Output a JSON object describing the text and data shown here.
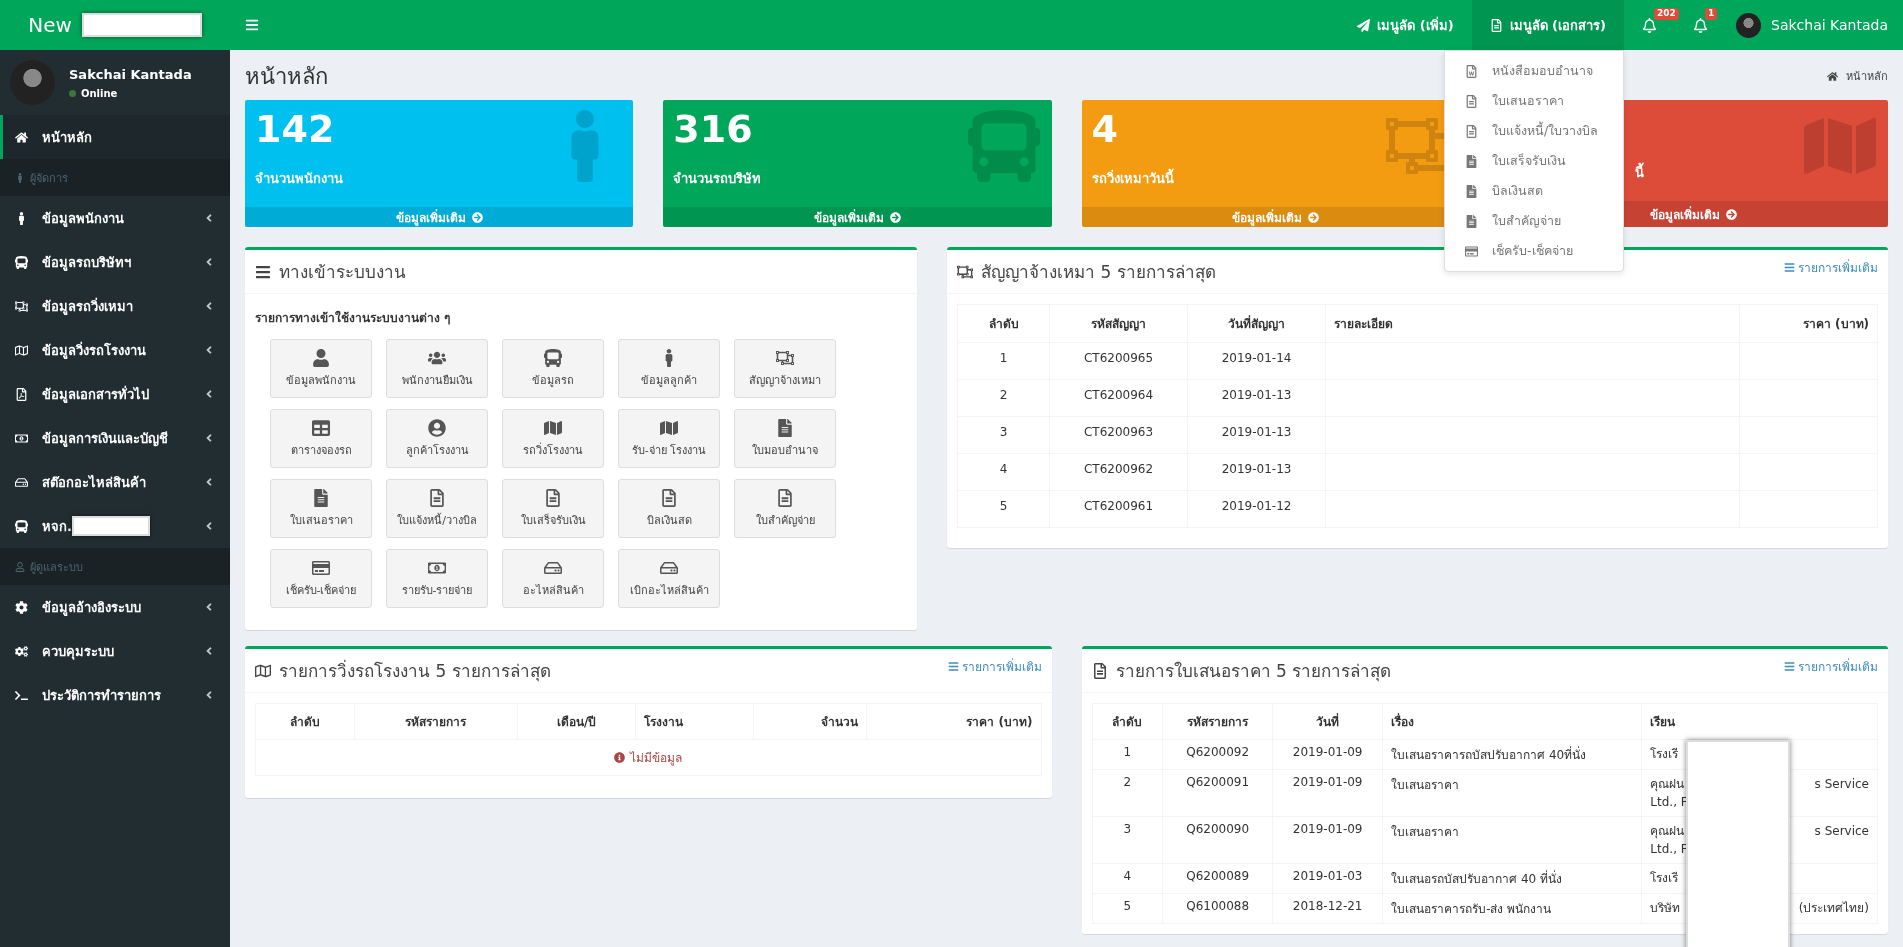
{
  "header": {
    "logo": {
      "text": "New",
      "redacted": true
    },
    "menu_links": [
      {
        "label": "เมนูลัด (เพิ่ม)",
        "selected": false
      },
      {
        "label": "เมนูลัด (เอกสาร)",
        "selected": true
      }
    ],
    "notifications": [
      {
        "badge": "202"
      },
      {
        "badge": "1"
      }
    ],
    "user": "Sakchai Kantada"
  },
  "dropdown": {
    "items": [
      "หนังสือมอบอำนาจ",
      "ใบเสนอราคา",
      "ใบแจ้งหนี้/ใบวางบิล",
      "ใบเสร็จรับเงิน",
      "บิลเงินสด",
      "ใบสำคัญจ่าย",
      "เช็ครับ-เช็คจ่าย"
    ]
  },
  "sidebar": {
    "user": {
      "name": "Sakchai Kantada",
      "status": "Online"
    },
    "items": [
      {
        "kind": "link",
        "label": "หน้าหลัก",
        "selected": true
      },
      {
        "kind": "section",
        "label": "ผู้จัดการ"
      },
      {
        "kind": "menu",
        "label": "ข้อมูลพนักงาน",
        "selected": false,
        "redacted": false
      },
      {
        "kind": "menu",
        "label": "ข้อมูลรถบริษัทฯ",
        "selected": false,
        "redacted": false
      },
      {
        "kind": "menu",
        "label": "ข้อมูลรถวิ่งเหมา",
        "selected": false,
        "redacted": false
      },
      {
        "kind": "menu",
        "label": "ข้อมูลวิ่งรถโรงงาน",
        "selected": false,
        "redacted": false
      },
      {
        "kind": "menu",
        "label": "ข้อมูลเอกสารทั่วไป",
        "selected": false,
        "redacted": false
      },
      {
        "kind": "menu",
        "label": "ข้อมูลการเงินและบัญชี",
        "selected": false,
        "redacted": false
      },
      {
        "kind": "menu",
        "label": "สต๊อกอะไหล่สินค้า",
        "selected": false,
        "redacted": false
      },
      {
        "kind": "menu",
        "label": "หจก.",
        "selected": false,
        "redacted": true
      },
      {
        "kind": "section",
        "label": "ผู้ดูแลระบบ"
      },
      {
        "kind": "menu",
        "label": "ข้อมูลอ้างอิงระบบ",
        "selected": false,
        "redacted": false
      },
      {
        "kind": "menu",
        "label": "ควบคุมระบบ",
        "selected": false,
        "redacted": false
      },
      {
        "kind": "menu",
        "label": "ประวัติการทำรายการ",
        "selected": false,
        "redacted": false
      }
    ]
  },
  "page": {
    "title": "หน้าหลัก",
    "breadcrumb": "หน้าหลัก"
  },
  "stat_cards": [
    {
      "number": "142",
      "title": "จำนวนพนักงาน",
      "link": "ข้อมูลเพิ่มเติม",
      "color": "#00c0ef"
    },
    {
      "number": "316",
      "title": "จำนวนรถบริษัท",
      "link": "ข้อมูลเพิ่มเติม",
      "color": "#00a65a"
    },
    {
      "number": "4",
      "title": "รถวิ่งเหมาวันนี้",
      "link": "ข้อมูลเพิ่มเติม",
      "color": "#f39c12"
    },
    {
      "title": "นี้",
      "link": "ข้อมูลเพิ่มเติม",
      "color": "#dd4b39"
    }
  ],
  "shortcuts": {
    "title": "ทางเข้าระบบงาน",
    "subtitle": "รายการทางเข้าใช้งานระบบงานต่าง ๆ",
    "tiles": [
      "ข้อมูลพนักงาน",
      "พนักงานยืมเงิน",
      "ข้อมูลรถ",
      "ข้อมูลลูกค้า",
      "สัญญาจ้างเหมา",
      "ตารางจองรถ",
      "ลูกค้าโรงงาน",
      "รถวิ่งโรงงาน",
      "รับ-จ่าย โรงงาน",
      "ใบมอบอำนาจ",
      "ใบเสนอราคา",
      "ใบแจ้งหนี้/วางบิล",
      "ใบเสร็จรับเงิน",
      "บิลเงินสด",
      "ใบสำคัญจ่าย",
      "เช็ครับ-เช็คจ่าย",
      "รายรับ-รายจ่าย",
      "อะไหล่สินค้า",
      "เบิกอะไหล่สินค้า"
    ]
  },
  "contracts": {
    "title": "สัญญาจ้างเหมา 5 รายการล่าสุด",
    "more": "รายการเพิ่มเติม",
    "columns": [
      "ลำดับ",
      "รหัสสัญญา",
      "วันที่สัญญา",
      "รายละเอียด",
      "ราคา (บาท)"
    ],
    "rows": [
      [
        "1",
        "CT6200965",
        "2019-01-14"
      ],
      [
        "2",
        "CT6200964",
        "2019-01-13"
      ],
      [
        "3",
        "CT6200963",
        "2019-01-13"
      ],
      [
        "4",
        "CT6200962",
        "2019-01-13"
      ],
      [
        "5",
        "CT6200961",
        "2019-01-12"
      ]
    ]
  },
  "factory_runs": {
    "title": "รายการวิ่งรถโรงงาน 5 รายการล่าสุด",
    "more": "รายการเพิ่มเติม",
    "columns": [
      "ลำดับ",
      "รหัสรายการ",
      "เดือน/ปี",
      "โรงงาน",
      "จำนวน",
      "ราคา (บาท)"
    ],
    "empty": "ไม่มีข้อมูล"
  },
  "quotations": {
    "title": "รายการใบเสนอราคา 5 รายการล่าสุด",
    "more": "รายการเพิ่มเติม",
    "columns": [
      "ลำดับ",
      "รหัสรายการ",
      "วันที่",
      "เรื่อง",
      "เรียน"
    ],
    "rows": [
      {
        "no": "1",
        "code": "Q6200092",
        "date": "2019-01-09",
        "subject": "ใบเสนอราคารถบัสปรับอากาศ 40ที่นั่ง",
        "recipient": [
          {
            "left": "โรงเรี"
          }
        ]
      },
      {
        "no": "2",
        "code": "Q6200091",
        "date": "2019-01-09",
        "subject": "ใบเสนอราคา",
        "recipient": [
          {
            "left": "คุณฝน",
            "right": "s Service"
          },
          {
            "left": "Ltd., F"
          }
        ]
      },
      {
        "no": "3",
        "code": "Q6200090",
        "date": "2019-01-09",
        "subject": "ใบเสนอราคา",
        "recipient": [
          {
            "left": "คุณฝน",
            "right": "s Service"
          },
          {
            "left": "Ltd., F"
          }
        ]
      },
      {
        "no": "4",
        "code": "Q6200089",
        "date": "2019-01-03",
        "subject": "ใบเสนอรถบัสปรับอากาศ 40 ที่นั่ง",
        "recipient": [
          {
            "left": "โรงเรี"
          }
        ]
      },
      {
        "no": "5",
        "code": "Q6100088",
        "date": "2018-12-21",
        "subject": "ใบเสนอราคารถรับ-ส่ง พนักงาน",
        "recipient": [
          {
            "left": "บริษัท",
            "right": "(ประเทศไทย)"
          }
        ]
      }
    ]
  }
}
